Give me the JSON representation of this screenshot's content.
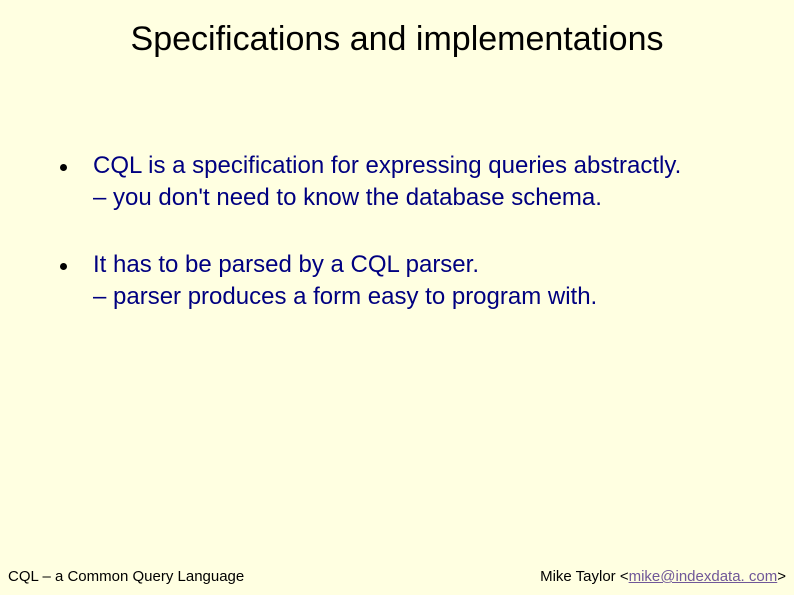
{
  "title": "Specifications and implementations",
  "bullets": [
    {
      "main": "CQL is a specification for expressing queries abstractly.",
      "sub": "– you don't need to know the database schema."
    },
    {
      "main": "It has to be parsed by a CQL parser.",
      "sub": "– parser produces a form easy to program with."
    }
  ],
  "footer": {
    "left": "CQL – a Common Query Language",
    "right_prefix": "Mike Taylor ",
    "angle_open": "<",
    "email": "mike@indexdata. com",
    "angle_close": ">"
  }
}
